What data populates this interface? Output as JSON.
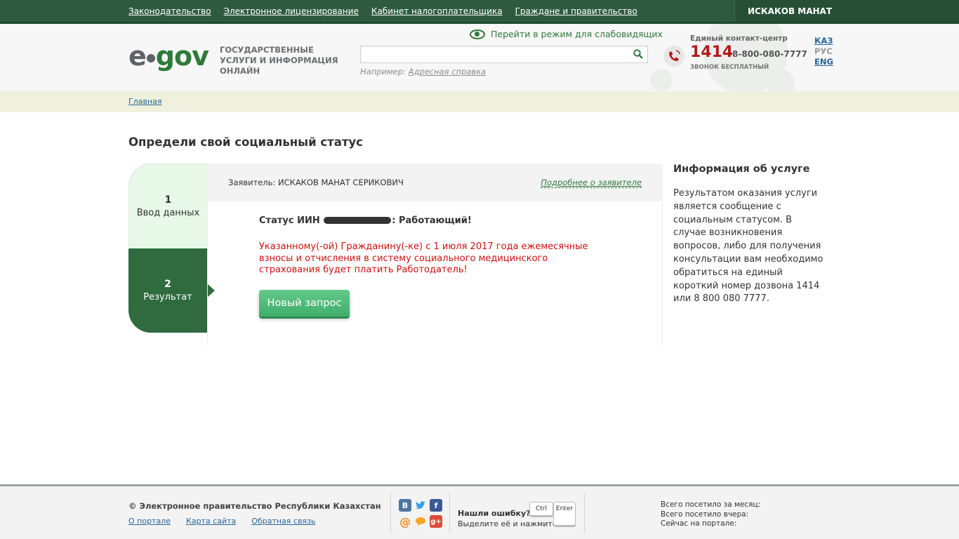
{
  "topnav": {
    "links": [
      "Законодательство",
      "Электронное лицензирование",
      "Кабинет налогоплательщика",
      "Граждане и правительство"
    ],
    "user": "ИСКАКОВ МАНАТ"
  },
  "header": {
    "logo_e": "e",
    "logo_gov": "gov",
    "tagline": "ГОСУДАРСТВЕННЫЕ УСЛУГИ И ИНФОРМАЦИЯ ОНЛАЙН",
    "low_vision": "Перейти в режим для слабовидящих",
    "search_value": "",
    "example_prefix": "Например:",
    "example_link": "Адресная справка",
    "contact_title": "Единый контакт-центр",
    "phone_short": "1414",
    "phone_long": "8-800-080-7777",
    "phone_free": "ЗВОНОК БЕСПЛАТНЫЙ",
    "langs": {
      "kaz": "КАЗ",
      "rus": "РУС",
      "eng": "ENG"
    }
  },
  "breadcrumb": {
    "home": "Главная"
  },
  "page_title": "Определи свой социальный статус",
  "wizard": {
    "steps": [
      {
        "num": "1",
        "label": "Ввод данных"
      },
      {
        "num": "2",
        "label": "Результат"
      }
    ],
    "applicant": "Заявитель: ИСКАКОВ МАНАТ СЕРИКОВИЧ",
    "more_link": "Подробнее о заявителе",
    "status_prefix": "Статус ИИН",
    "status_suffix": ": Работающий!",
    "warning": "Указанному(-ой) Гражданину(-ке) с 1 июля 2017 года ежемесячные взносы и отчисления в систему социального медицинского страхования будет платить Работодатель!",
    "new_request": "Новый запрос"
  },
  "info": {
    "title": "Информация об услуге",
    "text": "Результатом оказания услуги является сообщение с социальным статусом. В случае возникновения вопросов, либо для получения консультации вам необходимо обратиться на единый короткий номер дозвона 1414 или 8 800 080 7777."
  },
  "footer": {
    "copyright": "© Электронное правительство Республики Казахстан",
    "links": [
      "О портале",
      "Карта сайта",
      "Обратная связь"
    ],
    "error_title": "Нашли ошибку?",
    "error_text": "Выделите её и нажмите",
    "key_ctrl": "Ctrl",
    "key_enter": "Enter",
    "stats": [
      "Всего посетило за месяц:",
      "Всего посетило вчера:",
      "Сейчас на портале:"
    ]
  },
  "colors": {
    "brand_green": "#2f6b3f",
    "warning_red": "#cc1111",
    "phone_red": "#b31b1b"
  }
}
